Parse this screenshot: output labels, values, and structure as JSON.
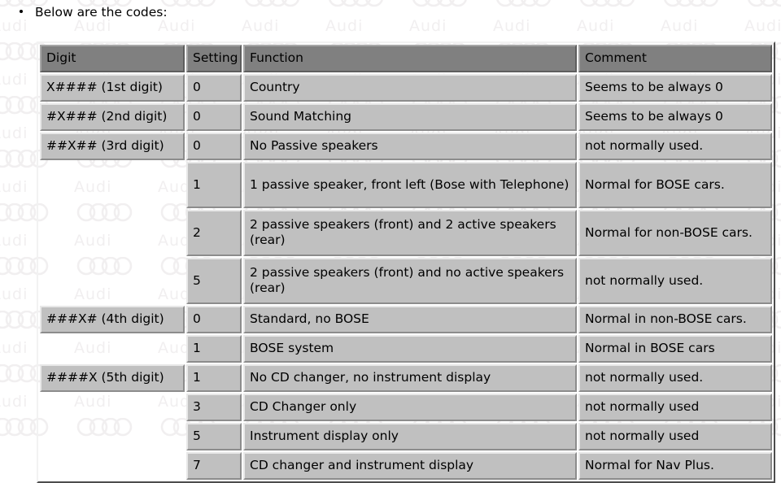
{
  "page": {
    "bullet_text": "Below are the codes:",
    "background_color": "#ffffff",
    "text_color": "#000000"
  },
  "watermark": {
    "text": "Audi",
    "logo": "audi-four-rings",
    "color": "#f1eff0"
  },
  "table": {
    "header_bg": "#808080",
    "cell_bg": "#c0c0c0",
    "columns": [
      {
        "key": "digit",
        "label": "Digit"
      },
      {
        "key": "setting",
        "label": "Setting"
      },
      {
        "key": "function",
        "label": "Function"
      },
      {
        "key": "comment",
        "label": "Comment"
      }
    ],
    "rows": [
      {
        "digit": "X#### (1st digit)",
        "digit_empty": false,
        "setting": "0",
        "function": "Country",
        "comment": "Seems to be always 0",
        "lines": 1
      },
      {
        "digit": "#X### (2nd digit)",
        "digit_empty": false,
        "setting": "0",
        "function": "Sound Matching",
        "comment": "Seems to be always 0",
        "lines": 1
      },
      {
        "digit": "##X## (3rd digit)",
        "digit_empty": false,
        "setting": "0",
        "function": "No Passive speakers",
        "comment": "not normally used.",
        "lines": 1
      },
      {
        "digit": "",
        "digit_empty": true,
        "setting": "1",
        "function": "1 passive speaker, front left (Bose with Telephone)",
        "comment": "Normal for BOSE cars.",
        "lines": 2
      },
      {
        "digit": "",
        "digit_empty": true,
        "setting": "2",
        "function": "2 passive speakers (front) and 2 active speakers (rear)",
        "comment": "Normal for non-BOSE cars.",
        "lines": 2
      },
      {
        "digit": "",
        "digit_empty": true,
        "setting": "5",
        "function": "2 passive speakers (front) and no active speakers (rear)",
        "comment": "not normally used.",
        "lines": 2
      },
      {
        "digit": "###X# (4th digit)",
        "digit_empty": false,
        "setting": "0",
        "function": "Standard, no BOSE",
        "comment": "Normal in non-BOSE cars.",
        "lines": 1
      },
      {
        "digit": "",
        "digit_empty": true,
        "setting": "1",
        "function": "BOSE system",
        "comment": "Normal in BOSE cars",
        "lines": 1
      },
      {
        "digit": "####X (5th digit)",
        "digit_empty": false,
        "setting": "1",
        "function": "No CD changer, no instrument display",
        "comment": "not normally used.",
        "lines": 1
      },
      {
        "digit": "",
        "digit_empty": true,
        "setting": "3",
        "function": "CD Changer only",
        "comment": "not normally used",
        "lines": 1
      },
      {
        "digit": "",
        "digit_empty": true,
        "setting": "5",
        "function": "Instrument display only",
        "comment": "not normally used",
        "lines": 1
      },
      {
        "digit": "",
        "digit_empty": true,
        "setting": "7",
        "function": "CD changer and instrument display",
        "comment": "Normal for Nav Plus.",
        "lines": 1
      }
    ]
  }
}
